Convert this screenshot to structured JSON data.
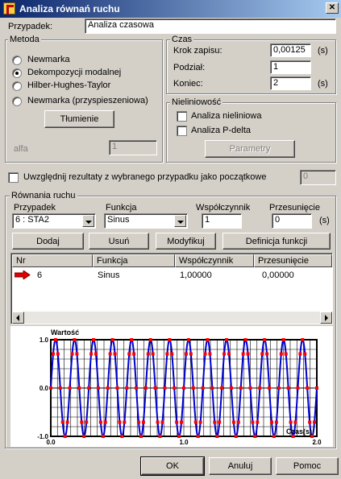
{
  "window": {
    "title": "Analiza równań ruchu",
    "close": "✕"
  },
  "case": {
    "label": "Przypadek:",
    "value": "Analiza czasowa"
  },
  "method": {
    "legend": "Metoda",
    "options": [
      "Newmarka",
      "Dekompozycji modalnej",
      "Hilber-Hughes-Taylor",
      "Newmarka (przyspieszeniowa)"
    ],
    "selected_index": 1,
    "damping_button": "Tłumienie",
    "alfa_label": "alfa",
    "alfa_value": "1"
  },
  "time": {
    "legend": "Czas",
    "step_label": "Krok zapisu:",
    "step_value": "0,00125",
    "step_unit": "(s)",
    "div_label": "Podział:",
    "div_value": "1",
    "end_label": "Koniec:",
    "end_value": "2",
    "end_unit": "(s)"
  },
  "nonlinear": {
    "legend": "Nieliniowość",
    "opt1": "Analiza nieliniowa",
    "opt2": "Analiza P-delta",
    "params_button": "Parametry"
  },
  "include_results": {
    "label": "Uwzględnij rezultaty z wybranego przypadku jako początkowe",
    "value": "0"
  },
  "equations": {
    "legend": "Równania ruchu",
    "case_label": "Przypadek",
    "case_value": "6 : STA2",
    "func_label": "Funkcja",
    "func_value": "Sinus",
    "coef_label": "Współczynnik",
    "coef_value": "1",
    "shift_label": "Przesunięcie",
    "shift_value": "0",
    "shift_unit": "(s)",
    "buttons": {
      "add": "Dodaj",
      "delete": "Usuń",
      "modify": "Modyfikuj",
      "define": "Definicja funkcji"
    },
    "table": {
      "headers": [
        "Nr",
        "Funkcja",
        "Współczynnik",
        "Przesunięcie"
      ],
      "rows": [
        {
          "nr": "6",
          "func": "Sinus",
          "coef": "1,00000",
          "shift": "0,00000"
        }
      ]
    }
  },
  "chart_data": {
    "type": "line",
    "ylabel": "Wartość",
    "xlabel": "Czas(s)",
    "xlim": [
      0,
      2.0
    ],
    "ylim": [
      -1.0,
      1.0
    ],
    "xticks": [
      "0.0",
      "1.0",
      "2.0"
    ],
    "yticks": [
      "1.0",
      "0.0",
      "-1.0"
    ],
    "function": "sin",
    "cycles": 14,
    "points_per_cycle": 8,
    "line_color": "#0000cc",
    "marker_color": "#ff0000",
    "grid": true
  },
  "footer": {
    "ok": "OK",
    "cancel": "Anuluj",
    "help": "Pomoc"
  }
}
